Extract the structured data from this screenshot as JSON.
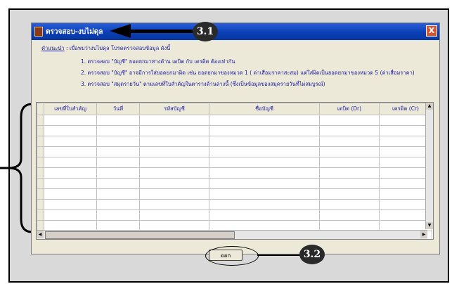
{
  "window": {
    "title": "ตรวจสอบ-งบไม่ดุล",
    "close_label": "X"
  },
  "instructions": {
    "lead_label": "คำแนะนำ",
    "lead_text": " : เมื่อพบว่างบไม่ดุล โปรดตรวจสอบข้อมูล ดังนี้",
    "items": [
      "1. ตรวจสอบ \"บัญชี\" ยอดยกมาทางด้าน เดบิต กับ เครดิต ต้องเท่ากัน",
      "2. ตรวจสอบ \"บัญชี\" อาจมีการใส่ยอดยกมาผิด  เช่น ยอดยกมาของหมวด 1 ( ค่าเสื่อมราคาสะสม) แต่ใส่ผิดเป็นยอดยกมาของหมวด 5 (ค่าเสื่อมราคา)",
      "3. ตรวจสอบ \"สมุดรายวัน\"  ตามเลขที่ใบสำคัญในตารางด้านล่างนี้ (ซึ่งเป็นข้อมูลของสมุดรายวันที่ไม่สมบูรณ์)"
    ]
  },
  "grid": {
    "columns": [
      "เลขที่ใบสำคัญ",
      "วันที่",
      "รหัสบัญชี",
      "ชื่อบัญชี",
      "เดบิต (Dr)",
      "เครดิต (Cr)"
    ],
    "rows": [
      [
        "",
        "",
        "",
        "",
        "",
        ""
      ],
      [
        "",
        "",
        "",
        "",
        "",
        ""
      ],
      [
        "",
        "",
        "",
        "",
        "",
        ""
      ],
      [
        "",
        "",
        "",
        "",
        "",
        ""
      ],
      [
        "",
        "",
        "",
        "",
        "",
        ""
      ],
      [
        "",
        "",
        "",
        "",
        "",
        ""
      ],
      [
        "",
        "",
        "",
        "",
        "",
        ""
      ],
      [
        "",
        "",
        "",
        "",
        "",
        ""
      ],
      [
        "",
        "",
        "",
        "",
        "",
        ""
      ],
      [
        "",
        "",
        "",
        "",
        "",
        ""
      ],
      [
        "",
        "",
        "",
        "",
        "",
        ""
      ],
      [
        "",
        "",
        "",
        "",
        "",
        ""
      ]
    ]
  },
  "footer": {
    "exit_label": "ออก"
  },
  "callouts": {
    "title_callout": "3.1",
    "exit_callout": "3.2"
  },
  "icons": [
    "app-icon",
    "close-icon",
    "scroll-up-icon",
    "scroll-down-icon",
    "scroll-left-icon",
    "scroll-right-icon"
  ]
}
